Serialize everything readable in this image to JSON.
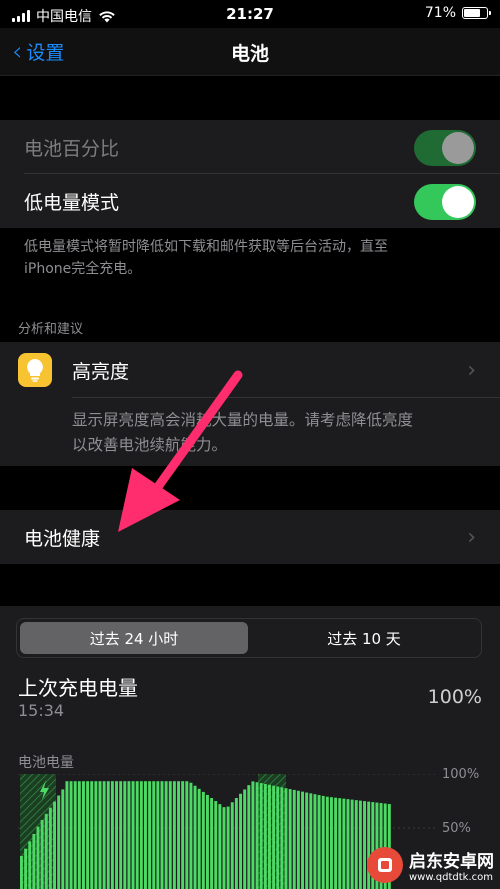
{
  "status_bar": {
    "carrier": "中国电信",
    "time": "21:27",
    "battery_percent": "71%",
    "battery_level": 0.71
  },
  "nav": {
    "back_label": "设置",
    "title": "电池"
  },
  "battery_settings": {
    "percentage_label": "电池百分比",
    "percentage_on": true,
    "low_power_label": "低电量模式",
    "low_power_on": true,
    "low_power_note_line1": "低电量模式将暂时降低如下载和邮件获取等后台活动，直至",
    "low_power_note_line2": "iPhone完全充电。"
  },
  "insights": {
    "header": "分析和建议",
    "item_label": "高亮度",
    "item_icon": "lightbulb-icon",
    "description_line1": "显示屏亮度高会消耗大量的电量。请考虑降低亮度",
    "description_line2": "以改善电池续航能力。"
  },
  "battery_health": {
    "label": "电池健康"
  },
  "usage": {
    "tabs": [
      "过去 24 小时",
      "过去 10 天"
    ],
    "selected_tab": 0,
    "last_charge_label": "上次充电电量",
    "last_charge_time": "15:34",
    "last_charge_value": "100%",
    "battery_level_label": "电池电量",
    "axis_top": "100%",
    "axis_mid": "50%"
  },
  "colors": {
    "accent": "#1a8cff",
    "toggle_on": "#34c759",
    "chart_green": "#4cd964",
    "arrow": "#ff2d6e",
    "bulb": "#f7c331"
  },
  "watermark": {
    "name": "启东安卓网",
    "url": "www.qdtdtk.com"
  }
}
